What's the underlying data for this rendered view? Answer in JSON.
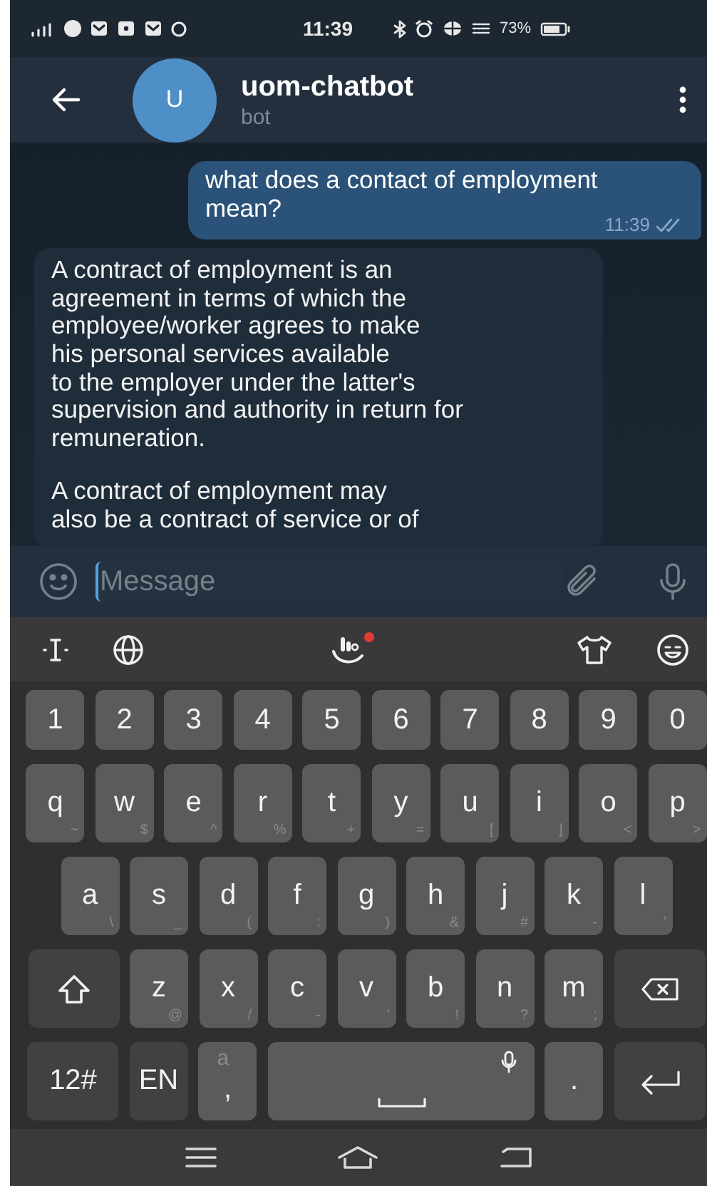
{
  "status_bar": {
    "time": "11:39",
    "battery": "73%"
  },
  "header": {
    "avatar_letter": "U",
    "title": "uom-chatbot",
    "subtitle": "bot"
  },
  "messages": [
    {
      "kind": "outgoing",
      "text": "what does a contact of employment\nmean?",
      "time": "11:39",
      "read": true
    },
    {
      "kind": "incoming",
      "paragraphs": [
        "A contract of employment is an\nagreement in terms of which the\nemployee/worker agrees to make\nhis personal services available\nto the employer under the latter's\nsupervision and authority in return for\nremuneration.",
        "A contract of employment may\nalso be a contract of service or of"
      ]
    }
  ],
  "composer": {
    "placeholder": "Message"
  },
  "keyboard": {
    "rows": [
      [
        {
          "kind": "char",
          "label": "1"
        },
        {
          "kind": "char",
          "label": "2"
        },
        {
          "kind": "char",
          "label": "3"
        },
        {
          "kind": "char",
          "label": "4"
        },
        {
          "kind": "char",
          "label": "5"
        },
        {
          "kind": "char",
          "label": "6"
        },
        {
          "kind": "char",
          "label": "7"
        },
        {
          "kind": "char",
          "label": "8"
        },
        {
          "kind": "char",
          "label": "9"
        },
        {
          "kind": "char",
          "label": "0"
        }
      ],
      [
        {
          "kind": "char",
          "label": "q",
          "hint": "~"
        },
        {
          "kind": "char",
          "label": "w",
          "hint": "$"
        },
        {
          "kind": "char",
          "label": "e",
          "hint": "^"
        },
        {
          "kind": "char",
          "label": "r",
          "hint": "%"
        },
        {
          "kind": "char",
          "label": "t",
          "hint": "+"
        },
        {
          "kind": "char",
          "label": "y",
          "hint": "="
        },
        {
          "kind": "char",
          "label": "u",
          "hint": "["
        },
        {
          "kind": "char",
          "label": "i",
          "hint": "]"
        },
        {
          "kind": "char",
          "label": "o",
          "hint": "<"
        },
        {
          "kind": "char",
          "label": "p",
          "hint": ">"
        }
      ],
      [
        {
          "kind": "char",
          "label": "a",
          "hint": "\\"
        },
        {
          "kind": "char",
          "label": "s",
          "hint": "_"
        },
        {
          "kind": "char",
          "label": "d",
          "hint": "("
        },
        {
          "kind": "char",
          "label": "f",
          "hint": ":"
        },
        {
          "kind": "char",
          "label": "g",
          "hint": ")"
        },
        {
          "kind": "char",
          "label": "h",
          "hint": "&"
        },
        {
          "kind": "char",
          "label": "j",
          "hint": "#"
        },
        {
          "kind": "char",
          "label": "k",
          "hint": "-"
        },
        {
          "kind": "char",
          "label": "l",
          "hint": "'"
        }
      ],
      [
        {
          "kind": "shift"
        },
        {
          "kind": "char",
          "label": "z",
          "hint": "@"
        },
        {
          "kind": "char",
          "label": "x",
          "hint": "/"
        },
        {
          "kind": "char",
          "label": "c",
          "hint": "-"
        },
        {
          "kind": "char",
          "label": "v",
          "hint": "'"
        },
        {
          "kind": "char",
          "label": "b",
          "hint": "!"
        },
        {
          "kind": "char",
          "label": "n",
          "hint": "?"
        },
        {
          "kind": "char",
          "label": "m",
          "hint": ";"
        },
        {
          "kind": "backspace"
        }
      ],
      [
        {
          "kind": "symbols",
          "label": "12#"
        },
        {
          "kind": "lang",
          "label": "EN"
        },
        {
          "kind": "comma",
          "label": ",",
          "hint": "a"
        },
        {
          "kind": "space"
        },
        {
          "kind": "period",
          "label": "."
        },
        {
          "kind": "enter"
        }
      ]
    ]
  }
}
